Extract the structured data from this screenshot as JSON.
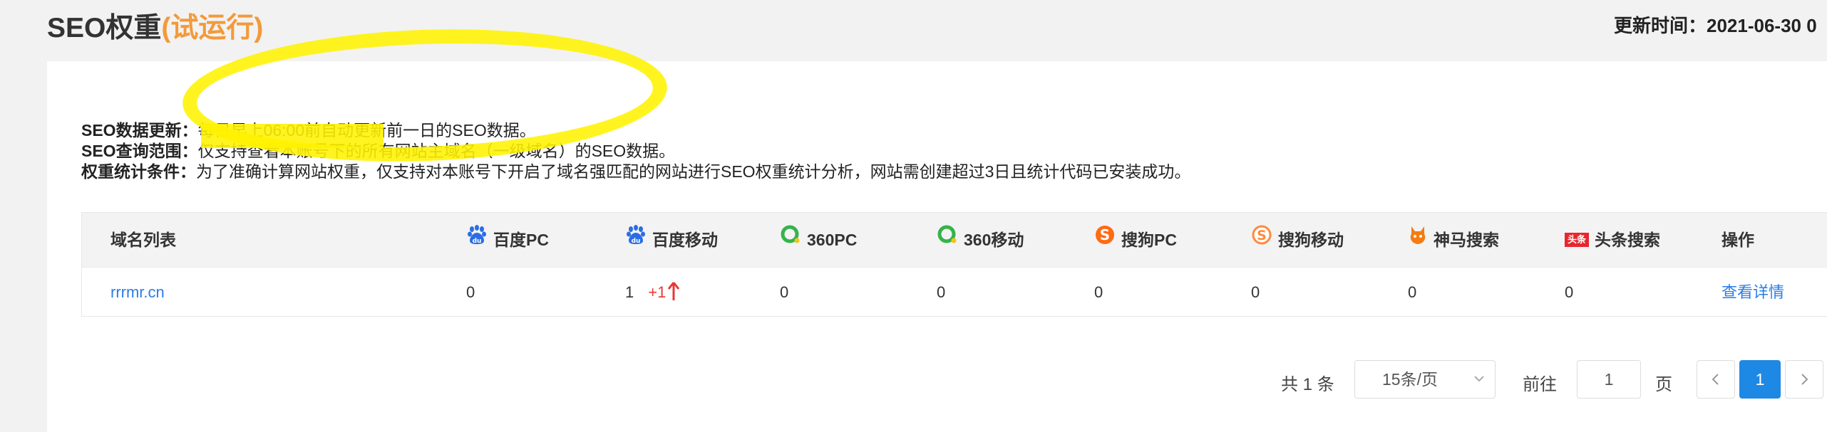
{
  "header": {
    "title": "SEO权重",
    "trial": "(试运行)",
    "update_label": "更新时间：",
    "update_value": "2021-06-30 0"
  },
  "info": [
    {
      "label": "SEO数据更新：",
      "text": "每日早上06:00前自动更新前一日的SEO数据。"
    },
    {
      "label": "SEO查询范围：",
      "text": "仅支持查看本账号下的所有网站主域名（一级域名）的SEO数据。"
    },
    {
      "label": "权重统计条件：",
      "text": "为了准确计算网站权重，仅支持对本账号下开启了域名强匹配的网站进行SEO权重统计分析，网站需创建超过3日且统计代码已安装成功。"
    }
  ],
  "table": {
    "columns": {
      "domain": "域名列表",
      "baidu_pc": "百度PC",
      "baidu_mobile": "百度移动",
      "s360_pc": "360PC",
      "s360_mobile": "360移动",
      "sogou_pc": "搜狗PC",
      "sogou_mobile": "搜狗移动",
      "shenma": "神马搜索",
      "toutiao": "头条搜索",
      "action": "操作"
    },
    "toutiao_badge": "头条",
    "rows": [
      {
        "domain": "rrrmr.cn",
        "baidu_pc": "0",
        "baidu_mobile": "1",
        "baidu_mobile_delta": "+1",
        "s360_pc": "0",
        "s360_mobile": "0",
        "sogou_pc": "0",
        "sogou_mobile": "0",
        "shenma": "0",
        "toutiao": "0",
        "action": "查看详情"
      }
    ]
  },
  "pagination": {
    "total_prefix": "共",
    "total": "1",
    "total_suffix": "条",
    "page_size": "15条/页",
    "goto_label": "前往",
    "goto_value": "1",
    "goto_suffix": "页",
    "current_page": "1"
  },
  "colors": {
    "accent": "#1e88e5",
    "trial": "#f39a3a",
    "increase": "#e53935",
    "highlight": "#fff300"
  }
}
